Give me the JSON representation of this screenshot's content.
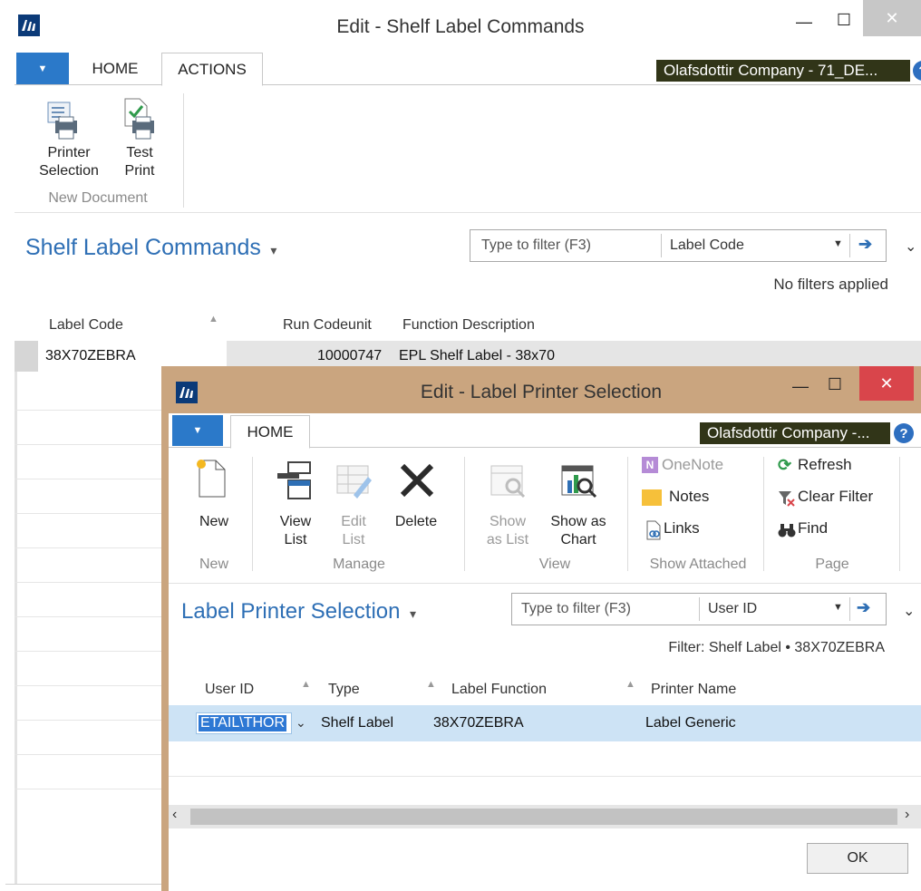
{
  "main": {
    "title": "Edit - Shelf Label Commands",
    "minimize": "—",
    "maximize": "☐",
    "close": "✕",
    "tabs": [
      "HOME",
      "ACTIONS"
    ],
    "company": "Olafsdottir Company - 71_DE...",
    "help": "?",
    "ribbon": {
      "printer_selection": [
        "Printer",
        "Selection"
      ],
      "test_print": [
        "Test",
        "Print"
      ],
      "group": "New Document"
    },
    "page_title": "Shelf Label Commands",
    "title_caret": "▾",
    "filter_placeholder": "Type to filter (F3)",
    "filter_field": "Label Code",
    "no_filters": "No filters applied",
    "columns": [
      "Label Code",
      "Run Codeunit",
      "Function Description"
    ],
    "rows": [
      {
        "label_code": "38X70ZEBRA",
        "run_codeunit": "10000747",
        "description": "EPL Shelf Label - 38x70"
      }
    ]
  },
  "dialog": {
    "title": "Edit - Label Printer Selection",
    "tab": "HOME",
    "company": "Olafsdottir Company -...",
    "help": "?",
    "ribbon": {
      "new": "New",
      "view_list": [
        "View",
        "List"
      ],
      "edit_list": [
        "Edit",
        "List"
      ],
      "delete": "Delete",
      "show_as_list": [
        "Show",
        "as List"
      ],
      "show_as_chart": [
        "Show as",
        "Chart"
      ],
      "onenote": "OneNote",
      "notes": "Notes",
      "links": "Links",
      "refresh": "Refresh",
      "clear_filter": "Clear Filter",
      "find": "Find",
      "groups": [
        "New",
        "Manage",
        "View",
        "Show Attached",
        "Page"
      ]
    },
    "page_title": "Label Printer Selection",
    "title_caret": "▾",
    "filter_placeholder": "Type to filter (F3)",
    "filter_field": "User ID",
    "filter_info": "Filter: Shelf Label • 38X70ZEBRA",
    "columns": [
      "User ID",
      "Type",
      "Label Function",
      "Printer Name"
    ],
    "rows": [
      {
        "user_id": "ETAIL\\THOR",
        "type": "Shelf Label",
        "label_function": "38X70ZEBRA",
        "printer_name": "Label Generic"
      }
    ],
    "ok": "OK"
  },
  "colors": {
    "accent_blue": "#2e6fb5",
    "file_tab": "#2b79c9",
    "company_bg": "#313518",
    "dialog_frame": "#caa57f",
    "dialog_close": "#d9454b",
    "selected_row": "#cde3f5"
  }
}
